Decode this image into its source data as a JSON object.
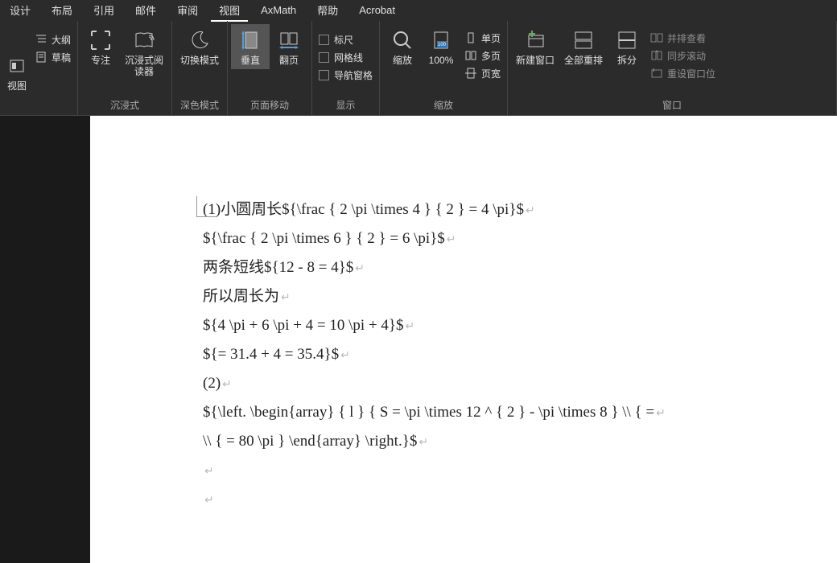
{
  "menu": {
    "items": [
      "设计",
      "布局",
      "引用",
      "邮件",
      "审阅",
      "视图",
      "AxMath",
      "帮助",
      "Acrobat"
    ],
    "active_index": 5
  },
  "ribbon": {
    "views": {
      "label": "视图",
      "outline": "大纲",
      "draft": "草稿"
    },
    "immersive": {
      "group_label": "沉浸式",
      "focus": "专注",
      "reader": "沉浸式阅读器"
    },
    "dark": {
      "group_label": "深色模式",
      "switch": "切换模式"
    },
    "pagemove": {
      "group_label": "页面移动",
      "vertical": "垂直",
      "flip": "翻页"
    },
    "display": {
      "group_label": "显示",
      "ruler": "标尺",
      "grid": "网格线",
      "nav": "导航窗格"
    },
    "zoom": {
      "group_label": "缩放",
      "zoom": "缩放",
      "hundred": "100%",
      "single": "单页",
      "multi": "多页",
      "width": "页宽"
    },
    "window": {
      "group_label": "窗口",
      "neww": "新建窗口",
      "arrange": "全部重排",
      "split": "拆分",
      "side": "并排查看",
      "sync": "同步滚动",
      "reset": "重设窗口位"
    }
  },
  "document": {
    "lines": [
      "(1)小圆周长${\\frac { 2 \\pi \\times 4 } { 2 } = 4 \\pi}$",
      "${\\frac { 2 \\pi \\times 6 } { 2 } = 6 \\pi}$",
      "两条短线${12 - 8 = 4}$",
      "所以周长为",
      "${4 \\pi + 6 \\pi + 4 = 10 \\pi + 4}$",
      "${= 31.4 + 4 = 35.4}$",
      "(2)",
      "${\\left. \\begin{array}    { l   }    { S = \\pi \\times 12 ^ { 2 } - \\pi \\times 8 } \\\\ { =",
      "\\\\ { = 80 \\pi } \\end{array} \\right.}$",
      "",
      ""
    ]
  }
}
